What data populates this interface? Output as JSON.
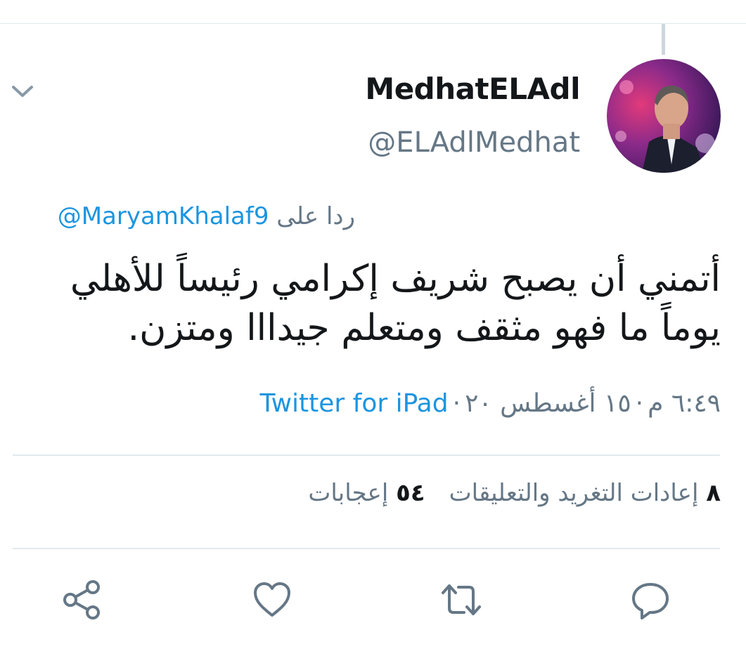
{
  "tweet": {
    "author": {
      "display_name": "MedhatELAdl",
      "handle": "@ELAdlMedhat"
    },
    "reply_to": {
      "label": "ردا على",
      "mention": "@MaryamKhalaf9"
    },
    "text": "أتمني أن يصبح شريف إكرامي رئيساً للأهلي يوماً ما فهو مثقف ومتعلم جيدااا ومتزن.",
    "timestamp": "٦:٤٩ م",
    "date": "١٥ أغسطس ٢٠",
    "separator": "·",
    "source": "Twitter for iPad",
    "stats": {
      "retweets_count": "٨",
      "retweets_label": "إعادات التغريد والتعليقات",
      "likes_count": "٥٤",
      "likes_label": "إعجابات"
    }
  },
  "icons": {
    "caret": "chevron-down-icon",
    "reply": "speech-bubble-icon",
    "retweet": "retweet-arrows-icon",
    "like": "heart-icon",
    "share": "share-nodes-icon"
  },
  "colors": {
    "link": "#1b95e0",
    "secondary_text": "#657786",
    "primary_text": "#14171a",
    "divider": "#e1e8ed"
  }
}
